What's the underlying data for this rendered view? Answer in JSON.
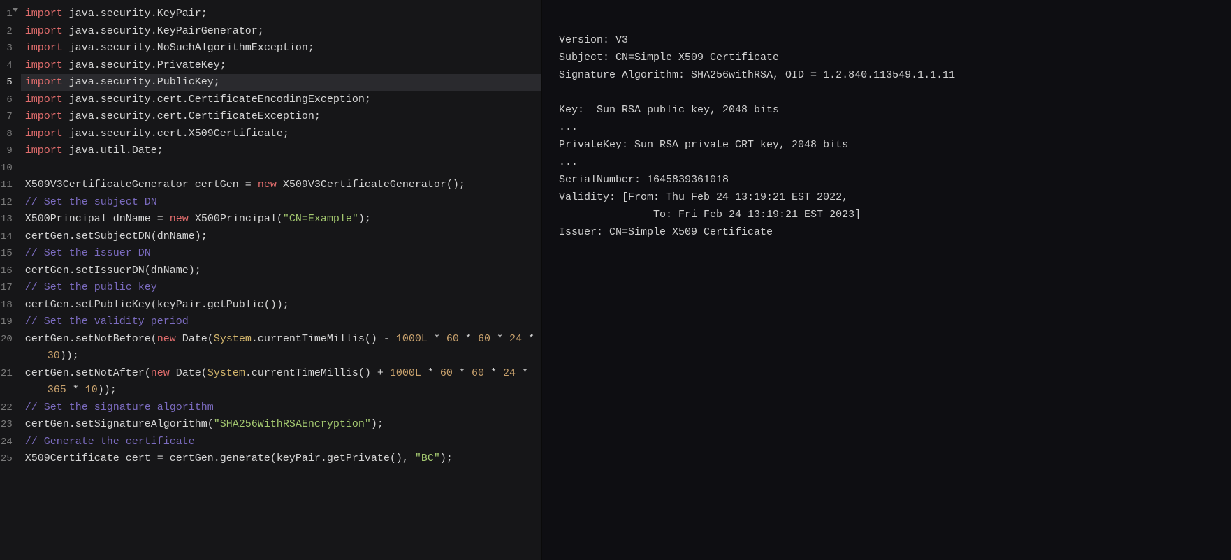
{
  "editor": {
    "active_line": 5,
    "lines": [
      {
        "n": 1,
        "tokens": [
          [
            "kw",
            "import"
          ],
          [
            "def",
            " java.security.KeyPair;"
          ]
        ]
      },
      {
        "n": 2,
        "tokens": [
          [
            "kw",
            "import"
          ],
          [
            "def",
            " java.security.KeyPairGenerator;"
          ]
        ]
      },
      {
        "n": 3,
        "tokens": [
          [
            "kw",
            "import"
          ],
          [
            "def",
            " java.security.NoSuchAlgorithmException;"
          ]
        ]
      },
      {
        "n": 4,
        "tokens": [
          [
            "kw",
            "import"
          ],
          [
            "def",
            " java.security.PrivateKey;"
          ]
        ]
      },
      {
        "n": 5,
        "tokens": [
          [
            "kw",
            "import"
          ],
          [
            "def",
            " java.security.PublicKey;"
          ]
        ]
      },
      {
        "n": 6,
        "tokens": [
          [
            "kw",
            "import"
          ],
          [
            "def",
            " java.security.cert.CertificateEncodingException;"
          ]
        ]
      },
      {
        "n": 7,
        "tokens": [
          [
            "kw",
            "import"
          ],
          [
            "def",
            " java.security.cert.CertificateException;"
          ]
        ]
      },
      {
        "n": 8,
        "tokens": [
          [
            "kw",
            "import"
          ],
          [
            "def",
            " java.security.cert.X509Certificate;"
          ]
        ]
      },
      {
        "n": 9,
        "tokens": [
          [
            "kw",
            "import"
          ],
          [
            "def",
            " java.util.Date;"
          ]
        ]
      },
      {
        "n": 10,
        "tokens": []
      },
      {
        "n": 11,
        "tokens": [
          [
            "def",
            "X509V3CertificateGenerator certGen = "
          ],
          [
            "new",
            "new"
          ],
          [
            "def",
            " X509V3CertificateGenerator();"
          ]
        ]
      },
      {
        "n": 12,
        "tokens": [
          [
            "cmt",
            "// Set the subject DN"
          ]
        ]
      },
      {
        "n": 13,
        "tokens": [
          [
            "def",
            "X500Principal dnName = "
          ],
          [
            "new",
            "new"
          ],
          [
            "def",
            " X500Principal("
          ],
          [
            "str",
            "\"CN=Example\""
          ],
          [
            "def",
            ");"
          ]
        ]
      },
      {
        "n": 14,
        "tokens": [
          [
            "def",
            "certGen.setSubjectDN(dnName);"
          ]
        ]
      },
      {
        "n": 15,
        "tokens": [
          [
            "cmt",
            "// Set the issuer DN"
          ]
        ]
      },
      {
        "n": 16,
        "tokens": [
          [
            "def",
            "certGen.setIssuerDN(dnName);"
          ]
        ]
      },
      {
        "n": 17,
        "tokens": [
          [
            "cmt",
            "// Set the public key"
          ]
        ]
      },
      {
        "n": 18,
        "tokens": [
          [
            "def",
            "certGen.setPublicKey(keyPair.getPublic());"
          ]
        ]
      },
      {
        "n": 19,
        "tokens": [
          [
            "cmt",
            "// Set the validity period"
          ]
        ]
      },
      {
        "n": 20,
        "tokens": [
          [
            "def",
            "certGen.setNotBefore("
          ],
          [
            "new",
            "new"
          ],
          [
            "def",
            " Date("
          ],
          [
            "sys",
            "System"
          ],
          [
            "def",
            ".currentTimeMillis() - "
          ],
          [
            "num",
            "1000L"
          ],
          [
            "def",
            " * "
          ],
          [
            "num",
            "60"
          ],
          [
            "def",
            " * "
          ],
          [
            "num",
            "60"
          ],
          [
            "def",
            " * "
          ],
          [
            "num",
            "24"
          ],
          [
            "def",
            " * "
          ]
        ]
      },
      {
        "n": 0,
        "indent": true,
        "tokens": [
          [
            "num",
            "30"
          ],
          [
            "def",
            "));"
          ]
        ]
      },
      {
        "n": 21,
        "tokens": [
          [
            "def",
            "certGen.setNotAfter("
          ],
          [
            "new",
            "new"
          ],
          [
            "def",
            " Date("
          ],
          [
            "sys",
            "System"
          ],
          [
            "def",
            ".currentTimeMillis() + "
          ],
          [
            "num",
            "1000L"
          ],
          [
            "def",
            " * "
          ],
          [
            "num",
            "60"
          ],
          [
            "def",
            " * "
          ],
          [
            "num",
            "60"
          ],
          [
            "def",
            " * "
          ],
          [
            "num",
            "24"
          ],
          [
            "def",
            " * "
          ]
        ]
      },
      {
        "n": 0,
        "indent": true,
        "tokens": [
          [
            "num",
            "365"
          ],
          [
            "def",
            " * "
          ],
          [
            "num",
            "10"
          ],
          [
            "def",
            "));"
          ]
        ]
      },
      {
        "n": 22,
        "tokens": [
          [
            "cmt",
            "// Set the signature algorithm"
          ]
        ]
      },
      {
        "n": 23,
        "tokens": [
          [
            "def",
            "certGen.setSignatureAlgorithm("
          ],
          [
            "str",
            "\"SHA256WithRSAEncryption\""
          ],
          [
            "def",
            ");"
          ]
        ]
      },
      {
        "n": 24,
        "tokens": [
          [
            "cmt",
            "// Generate the certificate"
          ]
        ]
      },
      {
        "n": 25,
        "tokens": [
          [
            "def",
            "X509Certificate cert = certGen.generate(keyPair.getPrivate(), "
          ],
          [
            "str",
            "\"BC\""
          ],
          [
            "def",
            ");"
          ]
        ]
      }
    ]
  },
  "output": {
    "lines": [
      "",
      "Version: V3",
      "Subject: CN=Simple X509 Certificate",
      "Signature Algorithm: SHA256withRSA, OID = 1.2.840.113549.1.1.11",
      "",
      "Key:  Sun RSA public key, 2048 bits",
      "...",
      "PrivateKey: Sun RSA private CRT key, 2048 bits",
      "...",
      "SerialNumber: 1645839361018",
      "Validity: [From: Thu Feb 24 13:19:21 EST 2022,",
      "               To: Fri Feb 24 13:19:21 EST 2023]",
      "Issuer: CN=Simple X509 Certificate"
    ]
  }
}
